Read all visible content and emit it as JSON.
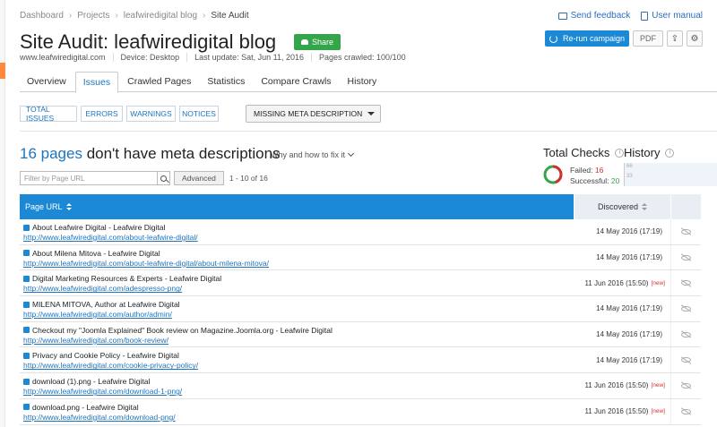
{
  "breadcrumb": [
    "Dashboard",
    "Projects",
    "leafwiredigital blog",
    "Site Audit"
  ],
  "top_links": {
    "feedback": "Send feedback",
    "manual": "User manual"
  },
  "title": "Site Audit: leafwiredigital blog",
  "share_label": "Share",
  "actions": {
    "rerun": "Re-run campaign",
    "pdf": "PDF"
  },
  "meta": {
    "domain": "www.leafwiredigital.com",
    "device": "Device: Desktop",
    "last_update": "Last update: Sat, Jun 11, 2016",
    "pages_crawled": "Pages crawled: 100/100"
  },
  "tabs": [
    "Overview",
    "Issues",
    "Crawled Pages",
    "Statistics",
    "Compare Crawls",
    "History"
  ],
  "active_tab": "Issues",
  "filters": [
    "TOTAL ISSUES",
    "ERRORS",
    "WARNINGS",
    "NOTICES"
  ],
  "issue_select": "MISSING META DESCRIPTION",
  "headline": {
    "count": "16 pages",
    "text": "don't have meta descriptions",
    "why": "Why and how to fix it"
  },
  "checks": {
    "title": "Total Checks",
    "failed_label": "Failed:",
    "failed": 16,
    "successful_label": "Successful:",
    "successful": 20,
    "history_title": "History",
    "history_axis": [
      "66",
      "33"
    ]
  },
  "search": {
    "placeholder": "Filter by Page URL",
    "advanced": "Advanced",
    "range": "1 - 10 of 16"
  },
  "table": {
    "col_url": "Page URL",
    "col_discovered": "Discovered",
    "rows": [
      {
        "title": "About Leafwire Digital - Leafwire Digital",
        "url": "http://www.leafwiredigital.com/about-leafwire-digital/",
        "date": "14 May 2016 (17:19)",
        "badge": ""
      },
      {
        "title": "About Milena Mitova - Leafwire Digital",
        "url": "http://www.leafwiredigital.com/about-leafwire-digital/about-milena-mitova/",
        "date": "14 May 2016 (17:19)",
        "badge": ""
      },
      {
        "title": "Digital Marketing Resources & Experts - Leafwire Digital",
        "url": "http://www.leafwiredigital.com/adespresso-png/",
        "date": "11 Jun 2016 (15:50)",
        "badge": "[new]"
      },
      {
        "title": "MILENA MITOVA, Author at Leafwire Digital",
        "url": "http://www.leafwiredigital.com/author/admin/",
        "date": "14 May 2016 (17:19)",
        "badge": ""
      },
      {
        "title": "Checkout my \"Joomla Explained\" Book review on Magazine.Joomla.org - Leafwire Digital",
        "url": "http://www.leafwiredigital.com/book-review/",
        "date": "14 May 2016 (17:19)",
        "badge": ""
      },
      {
        "title": "Privacy and Cookie Policy - Leafwire Digital",
        "url": "http://www.leafwiredigital.com/cookie-privacy-policy/",
        "date": "14 May 2016 (17:19)",
        "badge": ""
      },
      {
        "title": "download (1).png - Leafwire Digital",
        "url": "http://www.leafwiredigital.com/download-1-png/",
        "date": "11 Jun 2016 (15:50)",
        "badge": "[new]"
      },
      {
        "title": "download.png - Leafwire Digital",
        "url": "http://www.leafwiredigital.com/download-png/",
        "date": "11 Jun 2016 (15:50)",
        "badge": "[new]"
      }
    ]
  },
  "colors": {
    "accent": "#1c89d7",
    "share": "#35a54b",
    "failed": "#d32f2f",
    "success": "#35a54b"
  }
}
